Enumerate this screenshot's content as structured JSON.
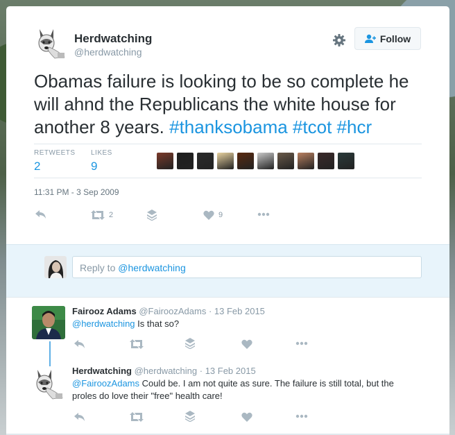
{
  "tweet": {
    "user_name": "Herdwatching",
    "user_handle": "@herdwatching",
    "follow_label": "Follow",
    "text_plain": "Obamas failure is looking to be so complete he will ahnd the Republicans the white house for another 8 years.",
    "hashtags": [
      "#thanksobama",
      "#tcot",
      "#hcr"
    ],
    "retweets_label": "RETWEETS",
    "retweets_count": "2",
    "likes_label": "LIKES",
    "likes_count": "9",
    "timestamp": "11:31 PM - 3 Sep 2009",
    "action_retweet_count": "2",
    "action_like_count": "9",
    "likers_colors": [
      "#7a3a2a",
      "#1e1e1e",
      "#2a2a2a",
      "#e8d2a0",
      "#5a2a10",
      "#c8c8c8",
      "#6a5a4a",
      "#b88060",
      "#3a2a2a",
      "#2a3a3a"
    ]
  },
  "reply_box": {
    "prefix": "Reply to ",
    "handle": "@herdwatching"
  },
  "replies": [
    {
      "name": "Fairooz Adams",
      "handle": "@FairoozAdams",
      "date": "· 13 Feb 2015",
      "mention": "@herdwatching",
      "text": " Is that so?"
    },
    {
      "name": "Herdwatching",
      "handle": "@herdwatching",
      "date": "· 13 Feb 2015",
      "mention": "@FairoozAdams",
      "text": " Could be. I am not quite as sure. The failure is still total, but the proles do love their \"free\" health care!"
    }
  ],
  "colors": {
    "link": "#1b95e0",
    "text": "#292f33",
    "muted": "#8899a6",
    "reply_bg": "#e8f4fb"
  },
  "icons": [
    "gear-icon",
    "follow-person-icon",
    "reply-icon",
    "retweet-icon",
    "stack-icon",
    "heart-icon",
    "more-icon"
  ]
}
